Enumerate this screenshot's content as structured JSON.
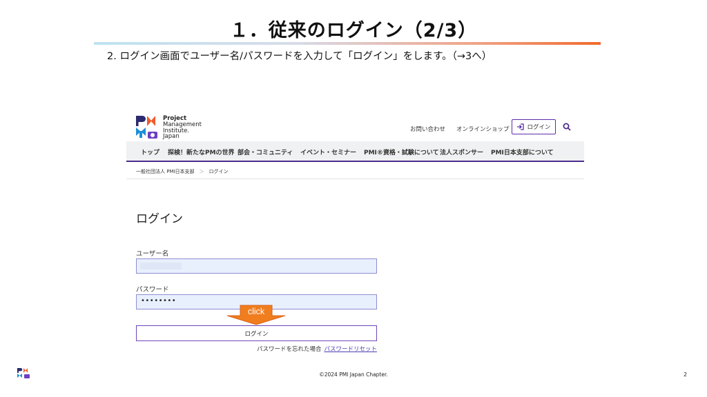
{
  "slide": {
    "title": "１．従来のログイン（2/3）",
    "instruction": "2. ログイン画面でユーザー名/パスワードを入力して「ログイン」をします。（→3へ）",
    "copyright": "©2024 PMI Japan Chapter.",
    "page_number": "2",
    "title_rule_colors": [
      "#bfe3f2",
      "#f16a2c"
    ]
  },
  "site": {
    "logo": {
      "line1": "Project",
      "line2": "Management",
      "line3": "Institute.",
      "line4": "Japan",
      "icon": "pmi-logo-icon"
    },
    "header_links": [
      "お問い合わせ",
      "オンラインショップ"
    ],
    "login_button": "ログイン",
    "nav": [
      "トップ",
      "探検！新たなPMの世界",
      "部会・コミュニティ",
      "イベント・セミナー",
      "PMI®資格・試験について",
      "法人スポンサー",
      "PMI日本支部について"
    ],
    "breadcrumb": [
      "一般社団法人 PMI日本支部",
      "ログイン"
    ],
    "breadcrumb_separator": "＞",
    "heading": "ログイン",
    "username_label": "ユーザー名",
    "password_label": "パスワード",
    "password_value": "••••••••",
    "submit_label": "ログイン",
    "forgot_text": "パスワードを忘れた場合",
    "reset_link": "パスワードリセット",
    "accent_color": "#5a2aa8"
  },
  "callout": {
    "label": "click",
    "color": "#f07d1e"
  }
}
